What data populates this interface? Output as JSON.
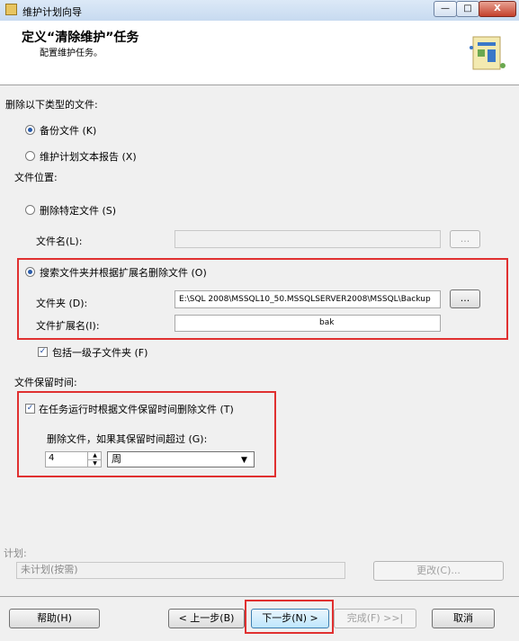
{
  "window": {
    "title": "维护计划向导",
    "min_label": "—",
    "max_label": "□",
    "close_label": "X"
  },
  "header": {
    "title": "定义“清除维护”任务",
    "subtitle": "配置维护任务。"
  },
  "delete_types": {
    "label": "删除以下类型的文件:",
    "backup_files": "备份文件 (K)",
    "report_files": "维护计划文本报告 (X)",
    "selected": "backup_files"
  },
  "file_location": {
    "label": "文件位置:",
    "delete_specific": "删除特定文件 (S)",
    "file_name_label": "文件名(L):",
    "file_name_value": "",
    "browse_label": "...",
    "search_folder": "搜索文件夹并根据扩展名删除文件 (O)",
    "folder_label": "文件夹 (D):",
    "folder_value": "E:\\SQL 2008\\MSSQL10_50.MSSQLSERVER2008\\MSSQL\\Backup",
    "folder_browse_label": "...",
    "ext_label": "文件扩展名(I):",
    "ext_value": "bak",
    "include_subfolders": "包括一级子文件夹 (F)",
    "include_subfolders_checked": true,
    "selected": "search_folder"
  },
  "retention": {
    "label": "文件保留时间:",
    "delete_by_age": "在任务运行时根据文件保留时间删除文件 (T)",
    "delete_by_age_checked": true,
    "older_than_label": "删除文件，如果其保留时间超过 (G):",
    "amount": "4",
    "unit": "周"
  },
  "schedule": {
    "label": "计划:",
    "value": "未计划(按需)",
    "change_label": "更改(C)..."
  },
  "footer": {
    "help": "帮助(H)",
    "back": "< 上一步(B)",
    "next": "下一步(N) >",
    "finish": "完成(F) >>|",
    "cancel": "取消"
  },
  "colors": {
    "highlight_box": "#e03030",
    "accent": "#2a5caa"
  }
}
